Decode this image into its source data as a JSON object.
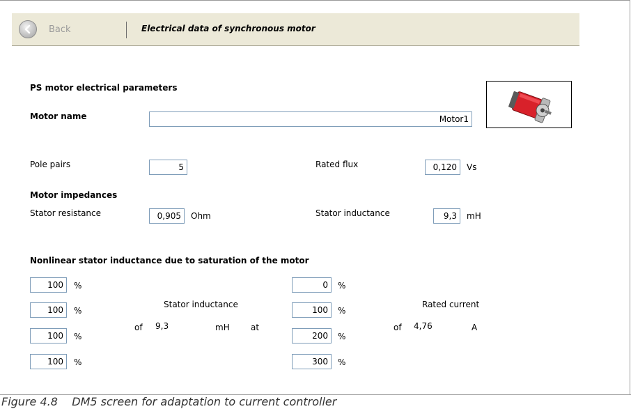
{
  "toolbar": {
    "back_label": "Back",
    "title": "Electrical data of synchronous motor"
  },
  "section": {
    "ps_title": "PS motor electrical parameters",
    "motor_name_label": "Motor name",
    "motor_name_value": "Motor1",
    "motor_image": "synchronous-motor-icon"
  },
  "params": {
    "pole_pairs_label": "Pole pairs",
    "pole_pairs_value": "5",
    "rated_flux_label": "Rated flux",
    "rated_flux_value": "0,120",
    "rated_flux_unit": "Vs",
    "impedances_title": "Motor impedances",
    "stator_res_label": "Stator resistance",
    "stator_res_value": "0,905",
    "stator_res_unit": "Ohm",
    "stator_ind_label": "Stator inductance",
    "stator_ind_value": "9,3",
    "stator_ind_unit": "mH"
  },
  "nonlinear": {
    "title": "Nonlinear stator inductance due to saturation of the motor",
    "percent_sign": "%",
    "inductance_values": [
      "100",
      "100",
      "100",
      "100"
    ],
    "current_values": [
      "0",
      "100",
      "200",
      "300"
    ],
    "stator_ind_label": "Stator inductance",
    "of_label": "of",
    "stator_ind_value": "9,3",
    "stator_ind_unit": "mH",
    "at_label": "at",
    "rated_current_label": "Rated current",
    "rated_current_value": "4,76",
    "rated_current_unit": "A"
  },
  "caption": "Figure 4.8    DM5 screen for adaptation to current controller"
}
